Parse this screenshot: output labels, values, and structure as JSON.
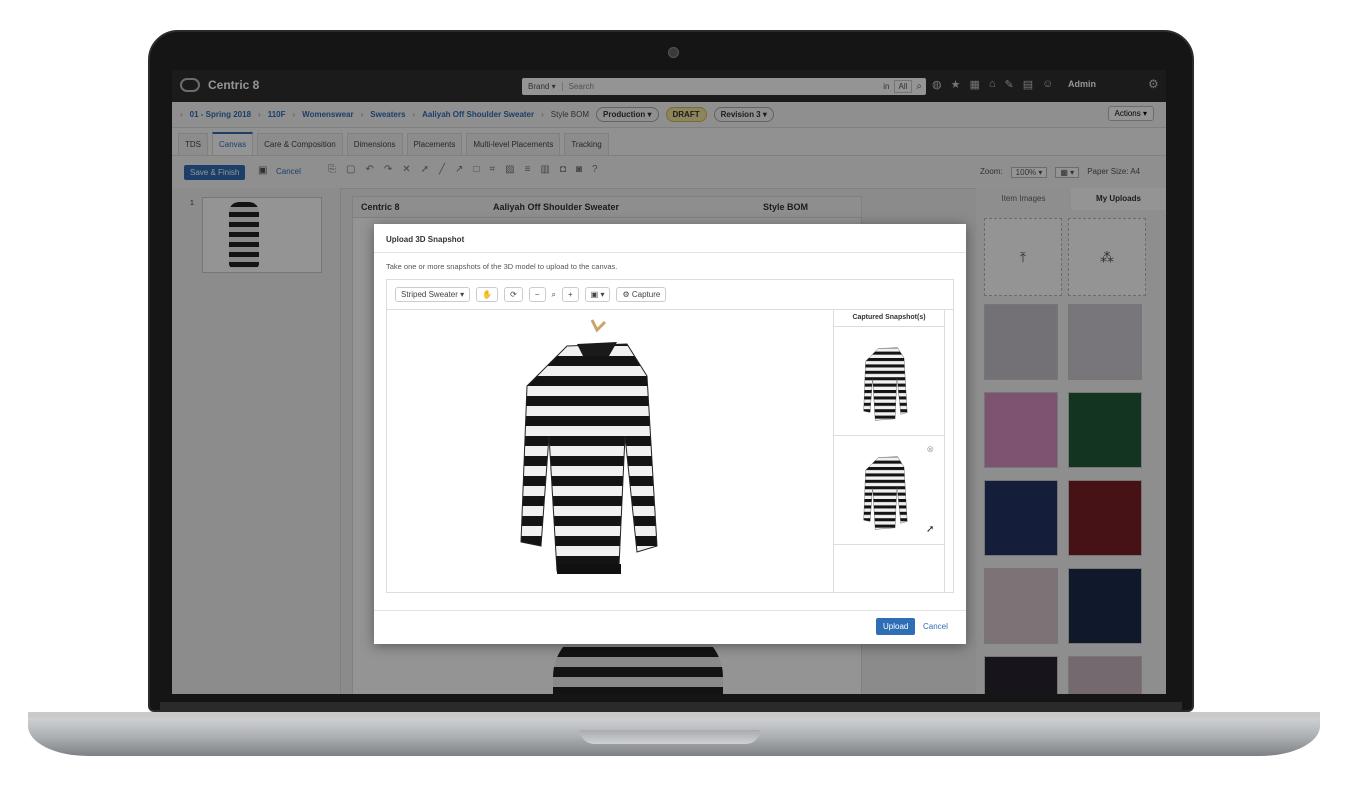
{
  "app": {
    "name": "Centric 8"
  },
  "topbar": {
    "search_scope": "Brand",
    "search_placeholder": "Search",
    "in_label": "in",
    "all_label": "All",
    "user": "Admin"
  },
  "breadcrumbs": [
    "01 - Spring 2018",
    "110F",
    "Womenswear",
    "Sweaters",
    "Aaliyah Off Shoulder Sweater"
  ],
  "doc_type": "Style BOM",
  "pills": {
    "production": "Production",
    "draft": "DRAFT",
    "revision": "Revision 3"
  },
  "actions_label": "Actions",
  "tabs": [
    "TDS",
    "Canvas",
    "Care & Composition",
    "Dimensions",
    "Placements",
    "Multi-level Placements",
    "Tracking"
  ],
  "toolbar": {
    "save": "Save & Finish",
    "cancel": "Cancel",
    "zoom_label": "Zoom:",
    "zoom_value": "100%",
    "paper": "Paper Size: A4"
  },
  "thumb_number": "1",
  "canvas": {
    "brand": "Centric 8",
    "title": "Aaliyah Off Shoulder Sweater",
    "type": "Style BOM"
  },
  "right_panel": {
    "tabs": [
      "Item Images",
      "My Uploads"
    ],
    "active_tab": "My Uploads"
  },
  "swatch_colors": [
    "#c9c3cb",
    "#cfcbd3",
    "#d98fc4",
    "#1f5a3a",
    "#243466",
    "#7a1f25",
    "#d4c7cc",
    "#1d2a4a",
    "#2a2430",
    "#c9b6bd"
  ],
  "dialog": {
    "title": "Upload 3D Snapshot",
    "description": "Take one or more snapshots of the 3D model to upload to the canvas.",
    "model_select": "Striped Sweater",
    "capture": "Capture",
    "captured_header": "Captured Snapshot(s)",
    "upload": "Upload",
    "cancel": "Cancel"
  }
}
